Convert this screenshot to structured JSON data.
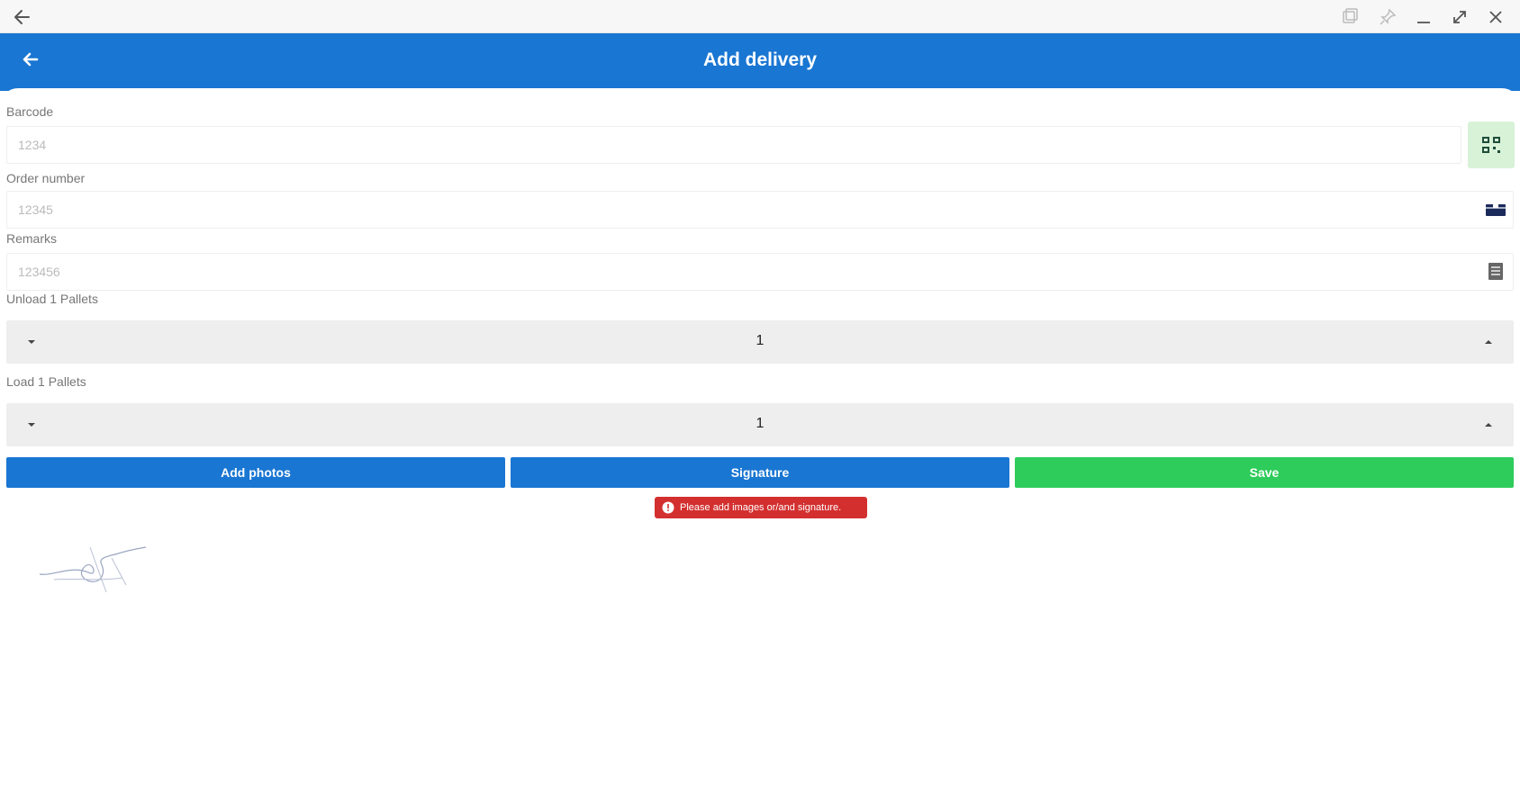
{
  "window": {
    "icons": [
      "back-arrow-icon",
      "screen-icon",
      "pin-icon",
      "minimize-icon",
      "expand-icon",
      "close-icon"
    ]
  },
  "appbar": {
    "title": "Add delivery",
    "color": "#1976d2",
    "back_icon": "arrow-left-icon"
  },
  "form": {
    "barcode": {
      "label": "Barcode",
      "value": "1234",
      "icon": "qr-scan-icon"
    },
    "order_number": {
      "label": "Order number",
      "value": "12345",
      "icon": "package-icon"
    },
    "remarks": {
      "label": "Remarks",
      "value": "123456",
      "icon": "notes-icon"
    },
    "unload_pallets": {
      "label": "Unload 1 Pallets",
      "value": "1"
    },
    "load_pallets": {
      "label": "Load 1 Pallets",
      "value": "1"
    }
  },
  "actions": {
    "add_photos": "Add photos",
    "signature": "Signature",
    "save": "Save",
    "colors": {
      "primary": "#1976d2",
      "success": "#2ecc5a"
    }
  },
  "error": {
    "message": "Please add images or/and signature.",
    "color": "#d32f2f",
    "icon": "alert-circle-icon"
  }
}
